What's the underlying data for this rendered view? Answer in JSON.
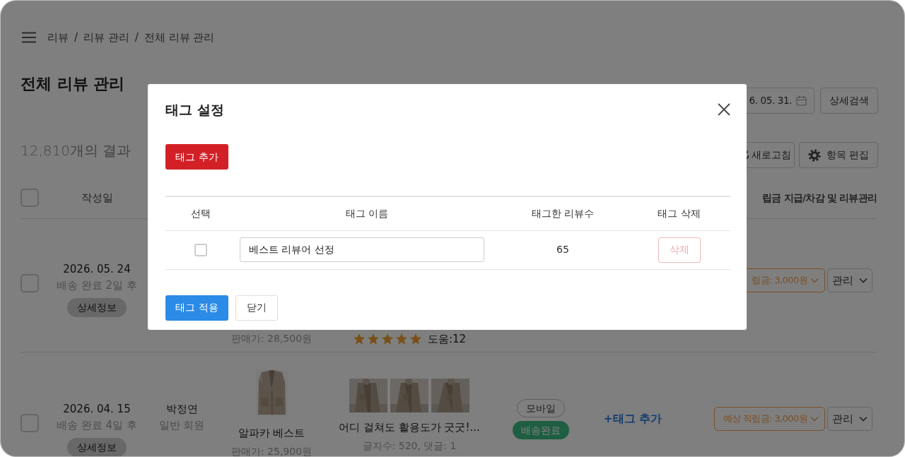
{
  "breadcrumb": {
    "items": [
      "리뷰",
      "리뷰 관리",
      "전체 리뷰 관리"
    ],
    "separator": "/"
  },
  "page_title": "전체 리뷰 관리",
  "date_field": {
    "value": "6. 05. 31."
  },
  "detail_search_button": "상세검색",
  "result_count": "12,810개의 결과",
  "toolbar_buttons": [
    {
      "kind": "refresh",
      "label": "새로고침"
    },
    {
      "kind": "settings",
      "label": "항목 편집"
    }
  ],
  "table": {
    "header_checked": false,
    "columns": [
      {
        "label": "작성일"
      },
      {
        "label": "립금 지급/차감 및 리뷰관리"
      }
    ],
    "rows": [
      {
        "checked": false,
        "date": "2026. 05. 24",
        "delivery": "배송 완료 2일 후",
        "detail_button": "상세정보",
        "price": "판매가: 28,500원",
        "stars": 5,
        "helpful": "도움:12",
        "reward_button": "립금: 3,000원",
        "manage_button": "관리"
      },
      {
        "checked": false,
        "date": "2026. 04. 15",
        "delivery": "배송 완료 4일 후",
        "detail_button": "상세정보",
        "author": "박정연",
        "member_type": "일반 회원",
        "product_name": "알파카 베스트",
        "price": "판매가: 25,900원",
        "review_text": "어디 걸쳐도 활용도가 굿굿!...",
        "review_meta": "글자수: 520, 댓글: 1",
        "channel": "모바일",
        "status": "배송완료",
        "tag_link": "+태그 추가",
        "reward_button": "예상 적립금: 3,000원",
        "manage_button": "관리"
      }
    ]
  },
  "modal": {
    "title": "태그 설정",
    "add_button": "태그 추가",
    "columns": [
      "선택",
      "태그 이름",
      "태그한 리뷰수",
      "태그 삭제"
    ],
    "rows": [
      {
        "checked": false,
        "name": "베스트 리뷰어 선정",
        "count": "65",
        "delete_button": "삭제"
      }
    ],
    "apply_button": "태그 적용",
    "close_button": "닫기"
  }
}
